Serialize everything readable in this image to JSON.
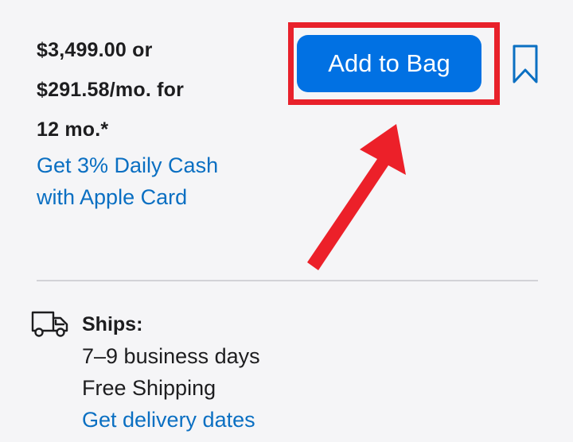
{
  "price": {
    "line1": "$3,499.00 or",
    "line2": "$291.58/mo. for",
    "line3": "12 mo.*",
    "daily_cash_line1": "Get 3% Daily Cash",
    "daily_cash_line2": "with Apple Card"
  },
  "actions": {
    "add_to_bag_label": "Add to Bag",
    "bookmark_icon": "bookmark-icon"
  },
  "shipping": {
    "title": "Ships:",
    "timeframe": "7–9 business days",
    "cost": "Free Shipping",
    "delivery_link": "Get delivery dates",
    "icon": "truck-icon"
  },
  "colors": {
    "background": "#f5f5f7",
    "button": "#0171e3",
    "link": "#0a6fc2",
    "annotation": "#e8212b",
    "text": "#1d1d1f"
  }
}
